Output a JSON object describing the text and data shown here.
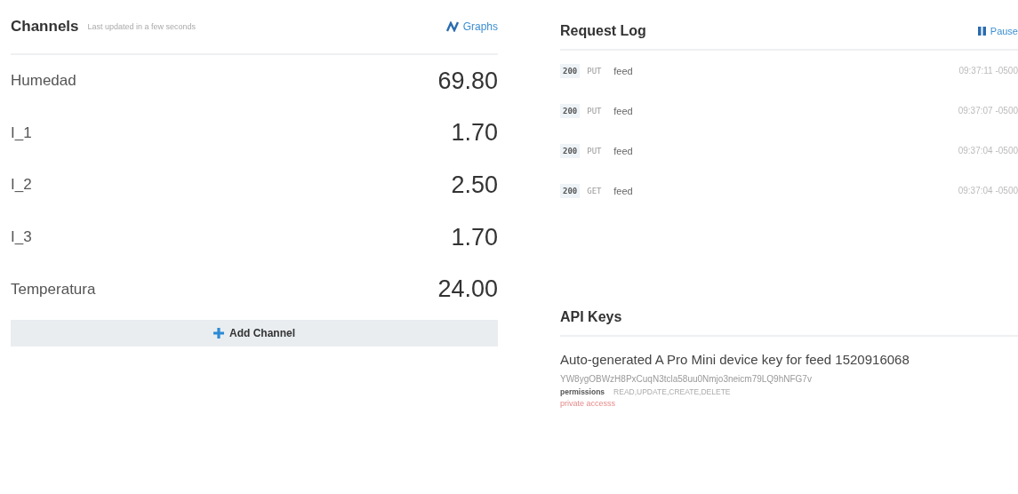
{
  "channels": {
    "title": "Channels",
    "updated": "Last updated in a few seconds",
    "graphs_link": "Graphs",
    "rows": [
      {
        "name": "Humedad",
        "value": "69.80"
      },
      {
        "name": "I_1",
        "value": "1.70"
      },
      {
        "name": "I_2",
        "value": "2.50"
      },
      {
        "name": "I_3",
        "value": "1.70"
      },
      {
        "name": "Temperatura",
        "value": "24.00"
      }
    ],
    "add_button": "Add Channel"
  },
  "request_log": {
    "title": "Request Log",
    "pause_button": "Pause",
    "rows": [
      {
        "status": "200",
        "method": "PUT",
        "path": "feed",
        "time": "09:37:11 -0500"
      },
      {
        "status": "200",
        "method": "PUT",
        "path": "feed",
        "time": "09:37:07 -0500"
      },
      {
        "status": "200",
        "method": "PUT",
        "path": "feed",
        "time": "09:37:04 -0500"
      },
      {
        "status": "200",
        "method": "GET",
        "path": "feed",
        "time": "09:37:04 -0500"
      }
    ]
  },
  "api_keys": {
    "title": "API Keys",
    "description": "Auto-generated A Pro Mini device key for feed 1520916068",
    "key": "YW8ygOBWzH8PxCuqN3tcla58uu0Nmjo3neicm79LQ9hNFG7v",
    "permissions_label": "permissions",
    "permissions": "READ,UPDATE,CREATE,DELETE",
    "access": "private accesss"
  }
}
